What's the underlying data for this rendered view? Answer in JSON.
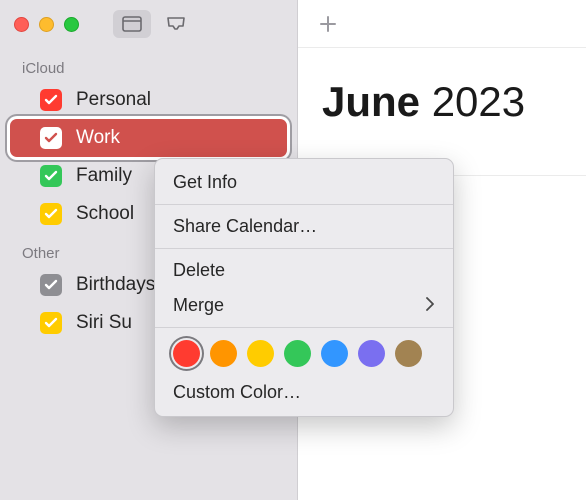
{
  "sidebar": {
    "sections": [
      {
        "title": "iCloud",
        "items": [
          {
            "label": "Personal",
            "color": "red"
          },
          {
            "label": "Work",
            "color": "red",
            "selected": true
          },
          {
            "label": "Family",
            "color": "green"
          },
          {
            "label": "School",
            "color": "yellow"
          }
        ]
      },
      {
        "title": "Other",
        "items": [
          {
            "label": "Birthdays",
            "color": "gray"
          },
          {
            "label": "Siri Suggestions",
            "color": "yellow"
          }
        ]
      }
    ]
  },
  "main": {
    "month": "June",
    "year": "2023"
  },
  "context_menu": {
    "items": {
      "get_info": "Get Info",
      "share": "Share Calendar…",
      "delete": "Delete",
      "merge": "Merge",
      "custom_color": "Custom Color…"
    },
    "colors": [
      "red",
      "orange",
      "yellow",
      "green",
      "blue",
      "purple",
      "brown"
    ],
    "selected_color": "red"
  }
}
